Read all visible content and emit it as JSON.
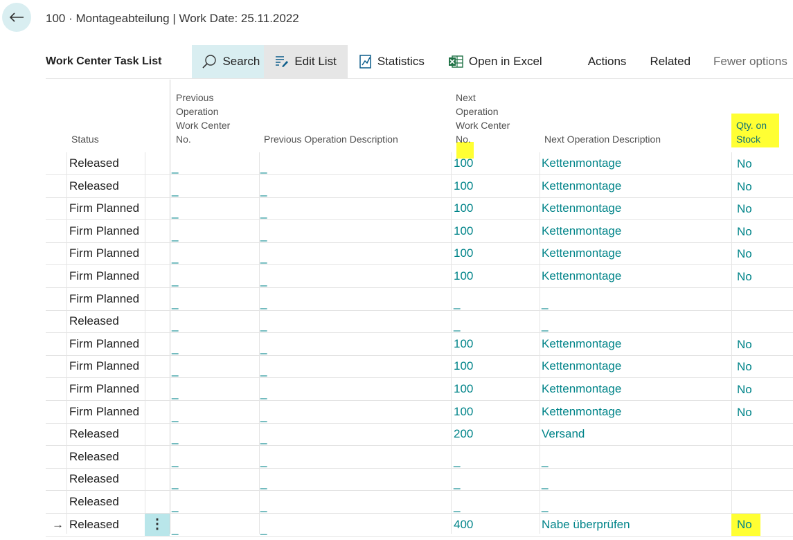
{
  "header": {
    "breadcrumb": "100 · Montageabteilung | Work Date: 25.11.2022"
  },
  "toolbar": {
    "title": "Work Center Task List",
    "search": "Search",
    "edit_list": "Edit List",
    "statistics": "Statistics",
    "open_excel": "Open in Excel",
    "actions": "Actions",
    "related": "Related",
    "fewer_options": "Fewer options"
  },
  "columns": {
    "status": "Status",
    "prev_no_1": "Previous",
    "prev_no_2": "Operation",
    "prev_no_3": "Work Center",
    "prev_no_4": "No.",
    "prev_desc": "Previous Operation Description",
    "next_no_1": "Next",
    "next_no_2": "Operation",
    "next_no_3": "Work Center",
    "next_no_4": "No.",
    "next_desc": "Next Operation Description",
    "qty_1": "Qty. on",
    "qty_2": "Stock"
  },
  "rows": [
    {
      "status": "Released",
      "prev_no": "_",
      "prev_desc": "_",
      "next_no": "100",
      "next_desc": "Kettenmontage",
      "qty": "No"
    },
    {
      "status": "Released",
      "prev_no": "_",
      "prev_desc": "_",
      "next_no": "100",
      "next_desc": "Kettenmontage",
      "qty": "No"
    },
    {
      "status": "Firm Planned",
      "prev_no": "_",
      "prev_desc": "_",
      "next_no": "100",
      "next_desc": "Kettenmontage",
      "qty": "No"
    },
    {
      "status": "Firm Planned",
      "prev_no": "_",
      "prev_desc": "_",
      "next_no": "100",
      "next_desc": "Kettenmontage",
      "qty": "No"
    },
    {
      "status": "Firm Planned",
      "prev_no": "_",
      "prev_desc": "_",
      "next_no": "100",
      "next_desc": "Kettenmontage",
      "qty": "No"
    },
    {
      "status": "Firm Planned",
      "prev_no": "_",
      "prev_desc": "_",
      "next_no": "100",
      "next_desc": "Kettenmontage",
      "qty": "No"
    },
    {
      "status": "Firm Planned",
      "prev_no": "_",
      "prev_desc": "_",
      "next_no": "_",
      "next_desc": "_",
      "qty": ""
    },
    {
      "status": "Released",
      "prev_no": "_",
      "prev_desc": "_",
      "next_no": "_",
      "next_desc": "_",
      "qty": ""
    },
    {
      "status": "Firm Planned",
      "prev_no": "_",
      "prev_desc": "_",
      "next_no": "100",
      "next_desc": "Kettenmontage",
      "qty": "No"
    },
    {
      "status": "Firm Planned",
      "prev_no": "_",
      "prev_desc": "_",
      "next_no": "100",
      "next_desc": "Kettenmontage",
      "qty": "No"
    },
    {
      "status": "Firm Planned",
      "prev_no": "_",
      "prev_desc": "_",
      "next_no": "100",
      "next_desc": "Kettenmontage",
      "qty": "No"
    },
    {
      "status": "Firm Planned",
      "prev_no": "_",
      "prev_desc": "_",
      "next_no": "100",
      "next_desc": "Kettenmontage",
      "qty": "No"
    },
    {
      "status": "Released",
      "prev_no": "_",
      "prev_desc": "_",
      "next_no": "200",
      "next_desc": "Versand",
      "qty": ""
    },
    {
      "status": "Released",
      "prev_no": "_",
      "prev_desc": "_",
      "next_no": "_",
      "next_desc": "_",
      "qty": ""
    },
    {
      "status": "Released",
      "prev_no": "_",
      "prev_desc": "_",
      "next_no": "_",
      "next_desc": "_",
      "qty": ""
    },
    {
      "status": "Released",
      "prev_no": "_",
      "prev_desc": "_",
      "next_no": "_",
      "next_desc": "_",
      "qty": ""
    },
    {
      "status": "Released",
      "prev_no": "_",
      "prev_desc": "_",
      "next_no": "400",
      "next_desc": "Nabe überprüfen",
      "qty": "No"
    }
  ],
  "selected_row_marker": "→",
  "row_menu_glyph": "⋮",
  "colors": {
    "accent": "#008489",
    "highlight": "#ffff33",
    "search_bg": "#d9eef1"
  },
  "icons": {
    "back": "back-arrow-icon",
    "search": "search-icon",
    "edit_list": "edit-list-icon",
    "statistics": "statistics-icon",
    "excel": "excel-icon"
  }
}
